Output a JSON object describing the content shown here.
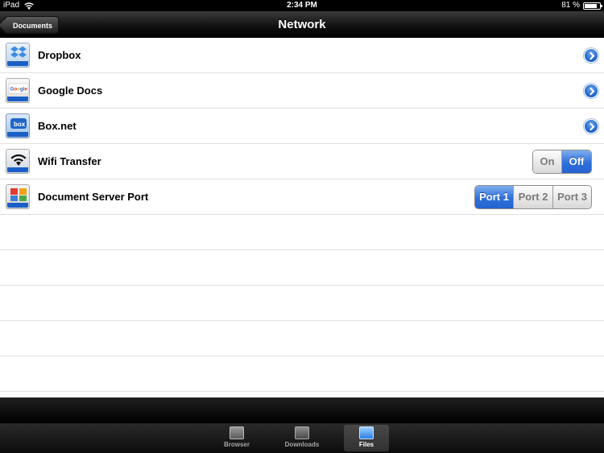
{
  "status_bar": {
    "device": "iPad",
    "time": "2:34 PM",
    "battery_percent": "81 %",
    "battery_level": 0.81
  },
  "nav": {
    "back_label": "Documents",
    "title": "Network"
  },
  "rows": [
    {
      "label": "Dropbox",
      "icon": "dropbox-icon",
      "accessory": "disclosure"
    },
    {
      "label": "Google Docs",
      "icon": "google-docs-icon",
      "accessory": "disclosure"
    },
    {
      "label": "Box.net",
      "icon": "box-net-icon",
      "accessory": "disclosure"
    },
    {
      "label": "Wifi Transfer",
      "icon": "wifi-transfer-icon",
      "accessory": "segmented",
      "options": [
        "On",
        "Off"
      ],
      "selected": "Off"
    },
    {
      "label": "Document Server Port",
      "icon": "document-server-icon",
      "accessory": "segmented",
      "options": [
        "Port 1",
        "Port 2",
        "Port 3"
      ],
      "selected": "Port 1"
    }
  ],
  "tabbar": {
    "tabs": [
      {
        "label": "Browser",
        "icon": "browser-icon",
        "active": false
      },
      {
        "label": "Downloads",
        "icon": "downloads-icon",
        "active": false
      },
      {
        "label": "Files",
        "icon": "files-icon",
        "active": true
      }
    ]
  },
  "colors": {
    "accent_blue": "#2f6fdc",
    "nav_black": "#000000"
  }
}
